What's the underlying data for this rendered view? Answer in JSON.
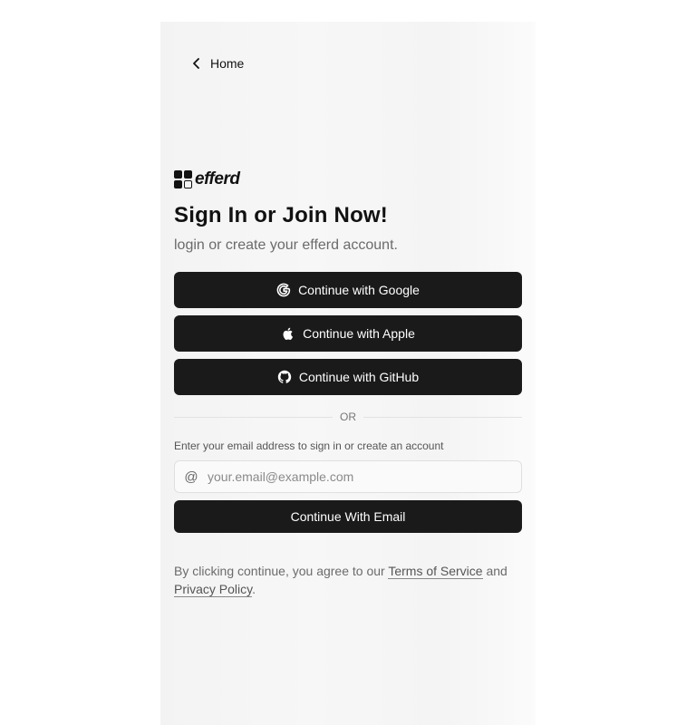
{
  "nav": {
    "home_label": "Home"
  },
  "brand": {
    "name": "efferd"
  },
  "heading": {
    "title": "Sign In or Join Now!",
    "subtitle": "login or create your efferd account."
  },
  "oauth": [
    {
      "label": "Continue with Google",
      "icon": "google-icon"
    },
    {
      "label": "Continue with Apple",
      "icon": "apple-icon"
    },
    {
      "label": "Continue with GitHub",
      "icon": "github-icon"
    }
  ],
  "divider": {
    "label": "OR"
  },
  "email": {
    "hint": "Enter your email address to sign in or create an account",
    "at_symbol": "@",
    "placeholder": "your.email@example.com",
    "value": "",
    "submit_label": "Continue With Email"
  },
  "legal": {
    "prefix": "By clicking continue, you agree to our ",
    "terms_label": "Terms of Service",
    "middle": " and",
    "privacy_label": "Privacy Policy",
    "suffix": "."
  },
  "colors": {
    "button_bg": "#1a1a1a",
    "panel_bg": "#f5f5f5",
    "muted_text": "#6b6b6b"
  }
}
